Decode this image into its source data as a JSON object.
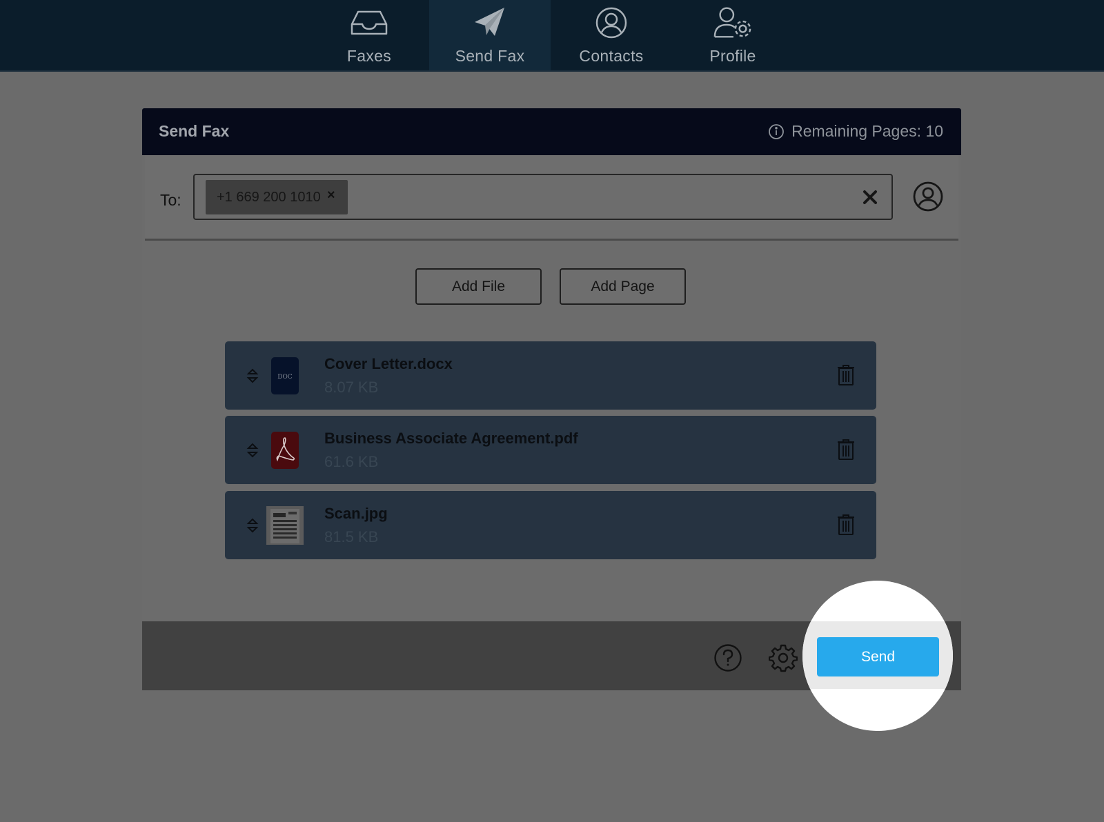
{
  "nav": {
    "items": [
      {
        "label": "Faxes",
        "icon": "inbox-tray-icon"
      },
      {
        "label": "Send Fax",
        "icon": "paper-plane-icon",
        "active": true
      },
      {
        "label": "Contacts",
        "icon": "user-circle-icon"
      },
      {
        "label": "Profile",
        "icon": "user-gear-icon"
      }
    ]
  },
  "dialog": {
    "title": "Send Fax",
    "remaining_pages": "Remaining Pages: 10"
  },
  "recipient": {
    "label": "To:",
    "chips": [
      {
        "value": "+1 669 200 1010",
        "remove": "×"
      }
    ]
  },
  "actions": {
    "add_file": "Add File",
    "add_page": "Add Page"
  },
  "files": [
    {
      "name": "Cover Letter.docx",
      "size": "8.07 KB",
      "type": "doc"
    },
    {
      "name": "Business Associate Agreement.pdf",
      "size": "61.6 KB",
      "type": "pdf"
    },
    {
      "name": "Scan.jpg",
      "size": "81.5 KB",
      "type": "jpg"
    }
  ],
  "doc_icon_label": "DOC",
  "footer": {
    "send_label": "Send"
  },
  "colors": {
    "nav_bg": "#0b1d2b",
    "header_bg": "#060a1a",
    "row_bg": "#263341",
    "send_button": "#27a9ec"
  }
}
